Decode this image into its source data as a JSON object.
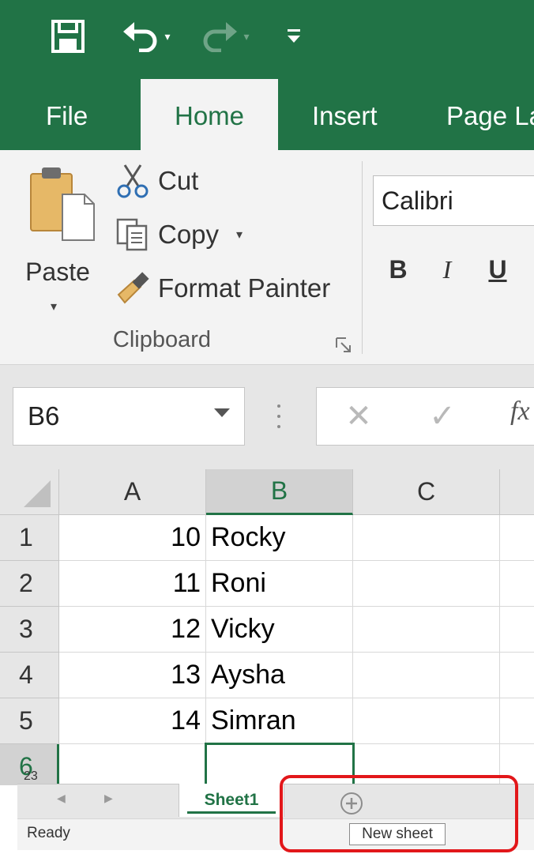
{
  "qat": {
    "save_icon": "save-icon",
    "undo_icon": "undo-icon",
    "redo_icon": "redo-icon",
    "customize_icon": "customize-qat-icon"
  },
  "tabs": {
    "file": "File",
    "home": "Home",
    "insert": "Insert",
    "page_layout": "Page La"
  },
  "clipboard": {
    "paste": "Paste",
    "cut": "Cut",
    "copy": "Copy",
    "format_painter": "Format Painter",
    "group_label": "Clipboard"
  },
  "font": {
    "name": "Calibri",
    "bold": "B",
    "italic": "I",
    "underline": "U"
  },
  "formula_bar": {
    "name_box": "B6",
    "fx": "fx"
  },
  "columns": [
    "A",
    "B",
    "C"
  ],
  "rows": [
    {
      "num": "1",
      "a": "10",
      "b": "Rocky"
    },
    {
      "num": "2",
      "a": "11",
      "b": "Roni"
    },
    {
      "num": "3",
      "a": "12",
      "b": "Vicky"
    },
    {
      "num": "4",
      "a": "13",
      "b": "Aysha"
    },
    {
      "num": "5",
      "a": "14",
      "b": "Simran"
    },
    {
      "num": "6",
      "a": "",
      "b": ""
    }
  ],
  "active_cell": "B6",
  "zoom_fragment": "23",
  "sheet_tab": "Sheet1",
  "status": "Ready",
  "tooltip": "New sheet",
  "colors": {
    "excel_green": "#217346",
    "highlight_red": "#e2171a"
  }
}
